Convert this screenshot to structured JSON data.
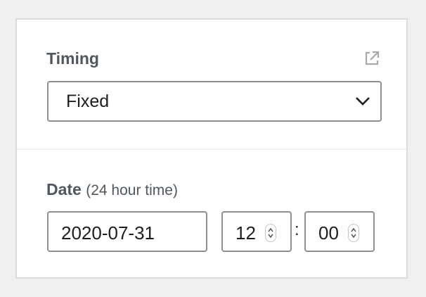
{
  "timing": {
    "label": "Timing",
    "external_link_icon": "external-link-icon",
    "selected_value": "Fixed",
    "chevron_icon": "chevron-down-icon"
  },
  "date": {
    "label": "Date",
    "note": "(24 hour time)",
    "date_value": "2020-07-31",
    "hour_value": "12",
    "separator": ":",
    "minute_value": "00",
    "stepper_icon": "spinner-arrows-icon"
  },
  "colors": {
    "border": "#8c8f94",
    "label": "#50575e",
    "divider": "#f0f0f1"
  }
}
